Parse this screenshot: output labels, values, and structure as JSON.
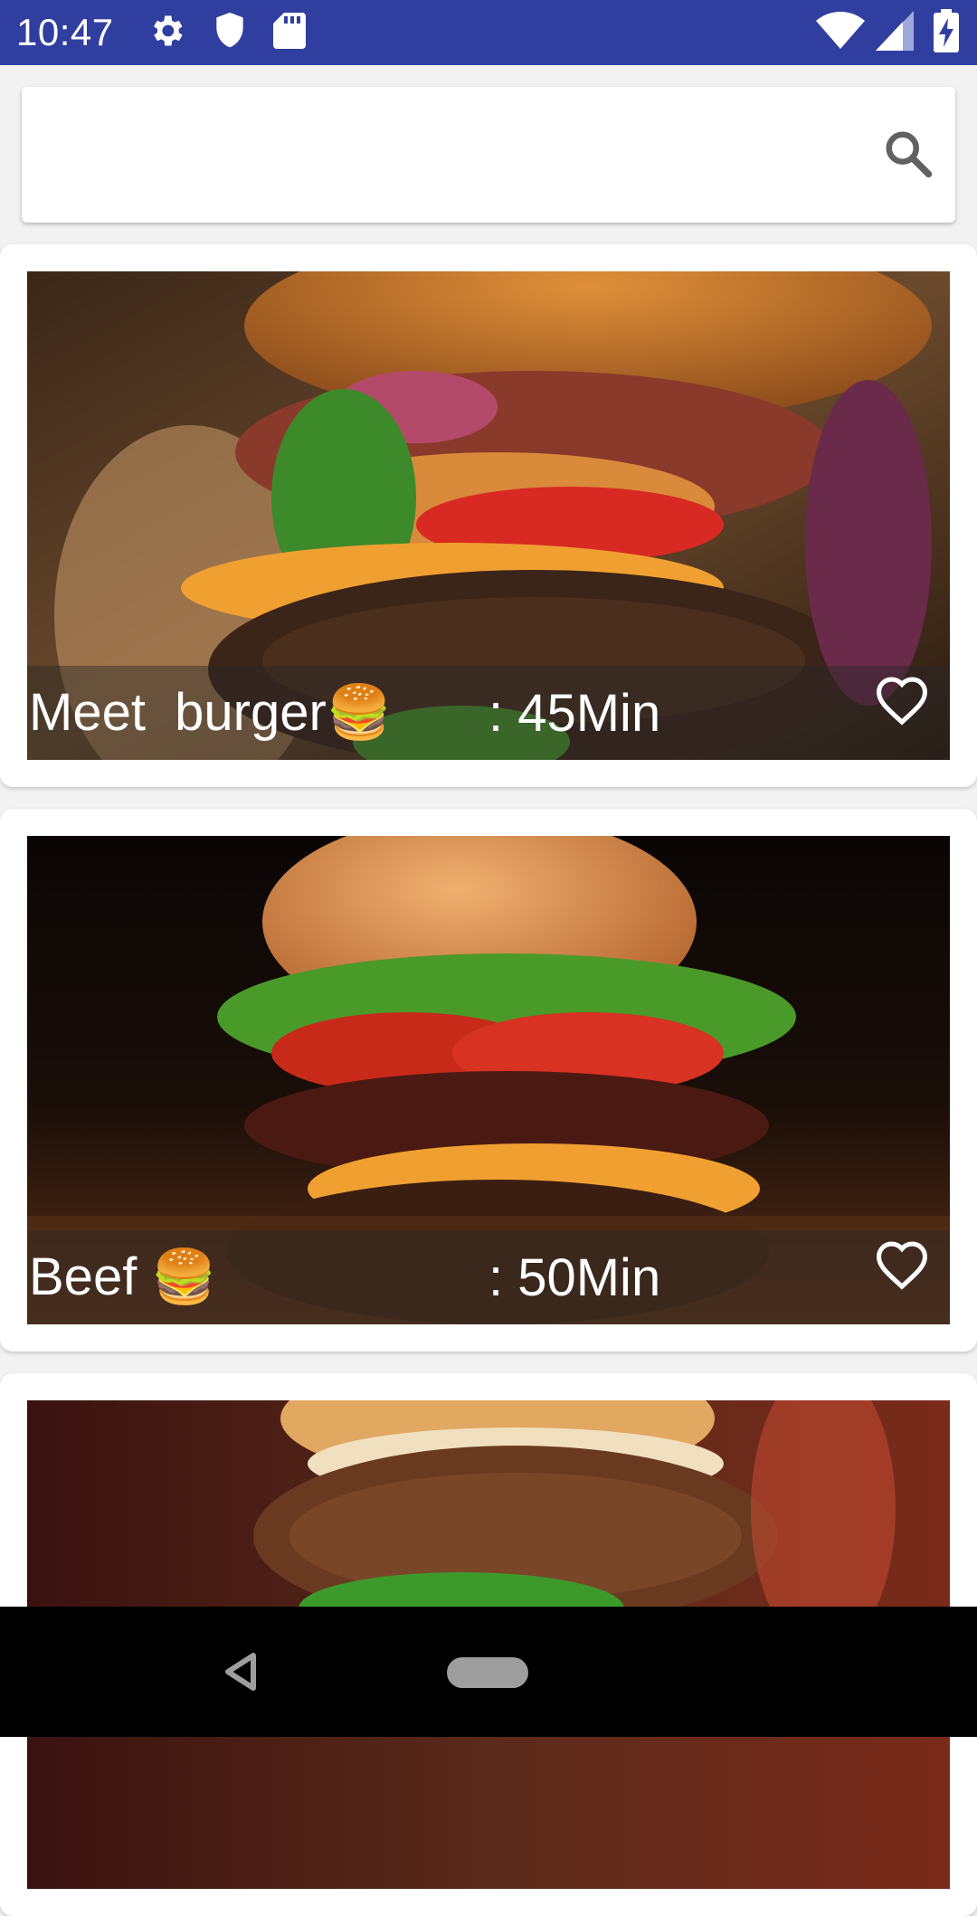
{
  "status_bar": {
    "time": "10:47",
    "icons": [
      "gear-icon",
      "shield-icon",
      "sd-card-icon",
      "wifi-icon",
      "cell-signal-icon",
      "battery-charging-icon"
    ],
    "background": "#303F9F"
  },
  "search": {
    "value": "",
    "placeholder": "",
    "icon": "search-icon"
  },
  "recipes": [
    {
      "name": "Meet  burger🍔",
      "time": ": 45Min",
      "favorite_icon": "heart-outline-icon"
    },
    {
      "name": "Beef 🍔",
      "time": ": 50Min",
      "favorite_icon": "heart-outline-icon"
    },
    {
      "name": "",
      "time": "",
      "favorite_icon": ""
    }
  ],
  "nav_bar": {
    "icons": [
      "back-icon",
      "home-pill-icon"
    ]
  }
}
